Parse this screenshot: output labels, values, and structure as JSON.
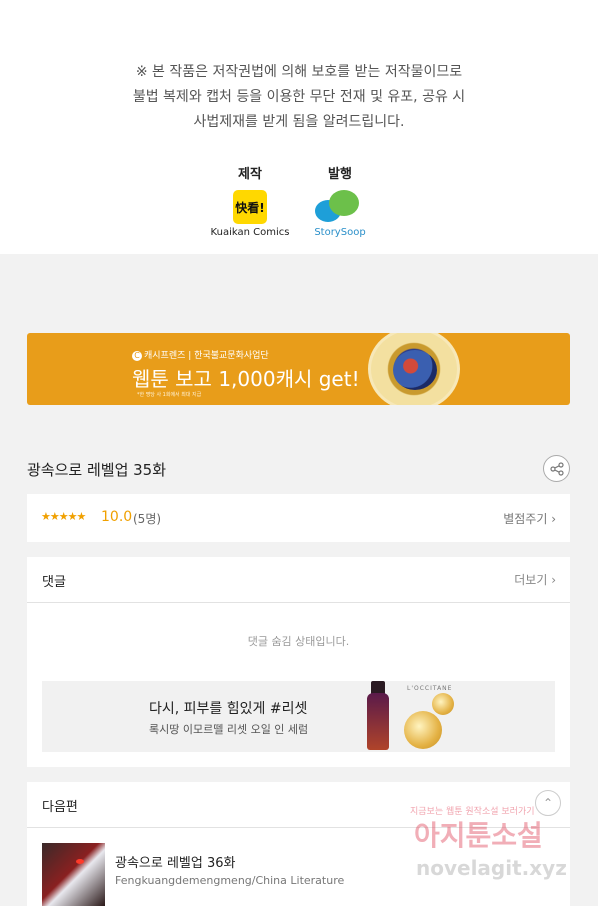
{
  "notice": {
    "line1": "※ 본 작품은 저작권법에 의해 보호를 받는 저작물이므로",
    "line2": "불법 복제와 캡처 등을 이용한 무단 전재 및 유포, 공유 시",
    "line3": "사법제재를 받게 됨을 알려드립니다.",
    "production_label": "제작",
    "production_logo_text": "快看!",
    "production_name": "Kuaikan Comics",
    "publisher_label": "발행",
    "publisher_name": "StorySoop"
  },
  "banner": {
    "top_left": "캐시프렌즈",
    "top_right": "한국불교문화사업단",
    "headline": "웹툰 보고 1,000캐시 get!",
    "fine_print": "*한 명당 사 1회에서 최대 지급"
  },
  "episode": {
    "title": "광속으로 레벨업 35화",
    "stars": "★★★★★",
    "score": "10.0",
    "rating_count": "(5명)",
    "rate_link": "별점주기 ›"
  },
  "comments": {
    "title": "댓글",
    "more": "더보기 ›",
    "hidden_message": "댓글 숨김 상태입니다."
  },
  "ad": {
    "headline": "다시, 피부를 힘있게 #리셋",
    "subtext": "록시땅 이모르뗄 리셋 오일 인 세럼",
    "brand": "L'OCCITANE"
  },
  "next": {
    "title": "다음편",
    "episode_title": "광속으로 레벨업 36화",
    "author": "Fengkuangdemengmeng/China Literature"
  },
  "watermark": {
    "top": "지금보는 웹툰 원작소설 보러가기",
    "main": "아지툰소설",
    "url": "novelagit.xyz"
  },
  "colors": {
    "banner_bg": "#e89d1a",
    "star_color": "#f0a000",
    "page_bg": "#f2f2f2"
  }
}
